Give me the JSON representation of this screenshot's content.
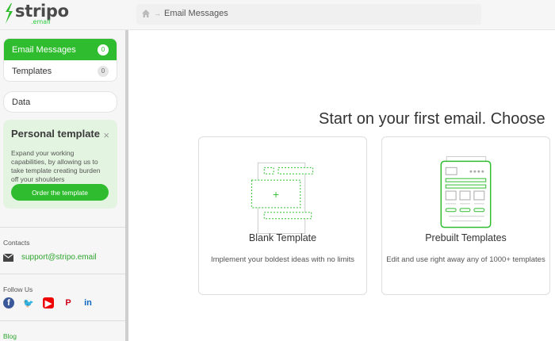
{
  "app": {
    "logo_text": "stripo",
    "logo_sub": ".email",
    "brand_color": "#2fbd2f"
  },
  "breadcrumb": {
    "icon": "home-icon",
    "current": "Email Messages"
  },
  "sidebar": {
    "nav": [
      {
        "label": "Email Messages",
        "count": "0",
        "active": true
      },
      {
        "label": "Templates",
        "count": "0",
        "active": false
      }
    ],
    "data_label": "Data",
    "promo": {
      "title": "Personal template",
      "close": "×",
      "text": "Expand your working capabilities, by allowing us to take template creating burden off your shoulders",
      "button": "Order the template"
    },
    "contacts_label": "Contacts",
    "contact_email": "support@stripo.email",
    "follow_label": "Follow Us",
    "social": [
      "facebook-icon",
      "twitter-icon",
      "youtube-icon",
      "pinterest-icon",
      "linkedin-icon"
    ],
    "blog_label": "Blog"
  },
  "main": {
    "title": "Start on your first email. Choose",
    "cards": [
      {
        "title": "Blank Template",
        "desc": "Implement your boldest ideas with no limits"
      },
      {
        "title": "Prebuilt Templates",
        "desc": "Edit and use right away any of 1000+ templates"
      }
    ]
  }
}
